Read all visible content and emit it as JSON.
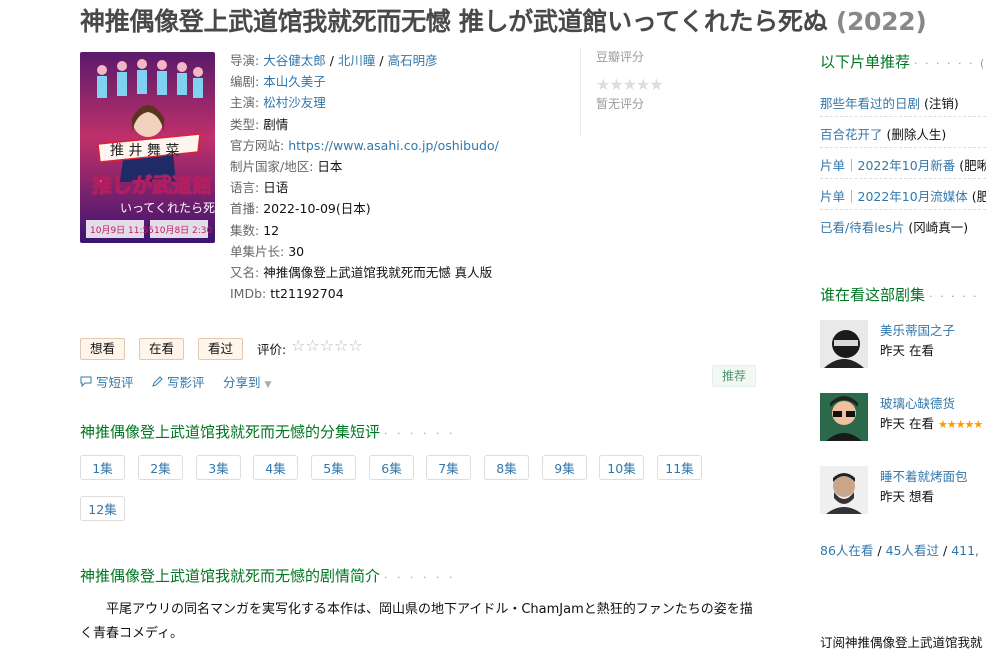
{
  "title": "神推偶像登上武道馆我就死而无憾 推しが武道館いってくれたら死ぬ",
  "year": "(2022)",
  "info": {
    "director_label": "导演:",
    "directors": [
      "大谷健太郎",
      "北川瞳",
      "高石明彦"
    ],
    "writer_label": "编剧:",
    "writer": "本山久美子",
    "cast_label": "主演:",
    "cast": "松村沙友理",
    "genre_label": "类型:",
    "genre": "剧情",
    "site_label": "官方网站:",
    "site": "https://www.asahi.co.jp/oshibudo/",
    "country_label": "制片国家/地区:",
    "country": "日本",
    "language_label": "语言:",
    "language": "日语",
    "premiere_label": "首播:",
    "premiere": "2022-10-09(日本)",
    "episodes_label": "集数:",
    "episodes": "12",
    "length_label": "单集片长:",
    "length": "30",
    "aka_label": "又名:",
    "aka": "神推偶像登上武道馆我就死而无憾 真人版",
    "imdb_label": "IMDb:",
    "imdb": "tt21192704"
  },
  "rating": {
    "label": "豆瓣评分",
    "stars": "★★★★★",
    "none": "暂无评分"
  },
  "buttons": {
    "want": "想看",
    "watching": "在看",
    "watched": "看过",
    "rate_label": "评价:",
    "rate_stars": "☆☆☆☆☆"
  },
  "actions": {
    "short_review": "写短评",
    "review": "写影评",
    "share": "分享到",
    "recommend": "推荐"
  },
  "episode_section": {
    "title": "神推偶像登上武道馆我就死而无憾的分集短评",
    "dots": "· · · · · ·",
    "episodes": [
      "1集",
      "2集",
      "3集",
      "4集",
      "5集",
      "6集",
      "7集",
      "8集",
      "9集",
      "10集",
      "11集",
      "12集"
    ]
  },
  "summary_section": {
    "title": "神推偶像登上武道馆我就死而无憾的剧情简介",
    "dots": "· · · · · ·",
    "text": "平尾アウリの同名マンガを実写化する本作は、岡山県の地下アイドル・ChamJamと熱狂的ファンたちの姿を描く青春コメディ。"
  },
  "sidebar": {
    "list_title": "以下片单推荐",
    "list_dots": "· · · · · · (",
    "lists": [
      {
        "name": "那些年看过的日剧",
        "note": "(注销)"
      },
      {
        "name": "百合花开了",
        "note": "(删除人生)"
      },
      {
        "name": "片单｜2022年10月新番",
        "note": "(肥啾"
      },
      {
        "name": "片单｜2022年10月流媒体",
        "note": "(肥"
      },
      {
        "name": "已看/待看les片",
        "note": "(冈崎真一)"
      }
    ],
    "watching_title": "谁在看这部剧集",
    "watching_dots": "· · · · ·",
    "watchers": [
      {
        "name": "美乐蒂国之子",
        "status": "昨天 在看",
        "stars": ""
      },
      {
        "name": "玻璃心缺德货",
        "status": "昨天 在看",
        "stars": "★★★★★"
      },
      {
        "name": "睡不着就烤面包",
        "status": "昨天 想看",
        "stars": ""
      }
    ],
    "counts": {
      "watching": "86人在看",
      "sep1": "/",
      "watched": "45人看过",
      "sep2": "/",
      "want": "411,"
    },
    "subscribe": "订阅神推偶像登上武道馆我就"
  }
}
